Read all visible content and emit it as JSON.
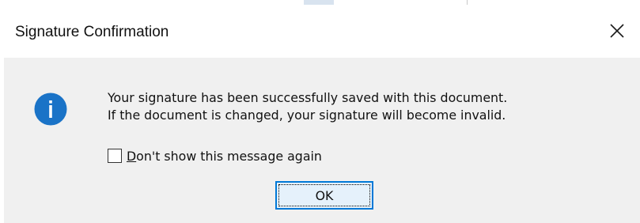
{
  "dialog": {
    "title": "Signature Confirmation",
    "close_icon": "close-icon",
    "info_icon": "info-icon",
    "message_line1": "Your signature has been successfully saved with this document.",
    "message_line2": "If the document is changed, your signature will become invalid.",
    "checkbox": {
      "accelerator": "D",
      "label_rest": "on't show this message again",
      "checked": false
    },
    "ok_label": "OK"
  },
  "colors": {
    "dialog_body": "#f0f0f0",
    "title_bar": "#ffffff",
    "info_icon_fill": "#1a73c7",
    "ok_button_border": "#0078d7",
    "ok_button_fill": "#e5f1fb"
  }
}
